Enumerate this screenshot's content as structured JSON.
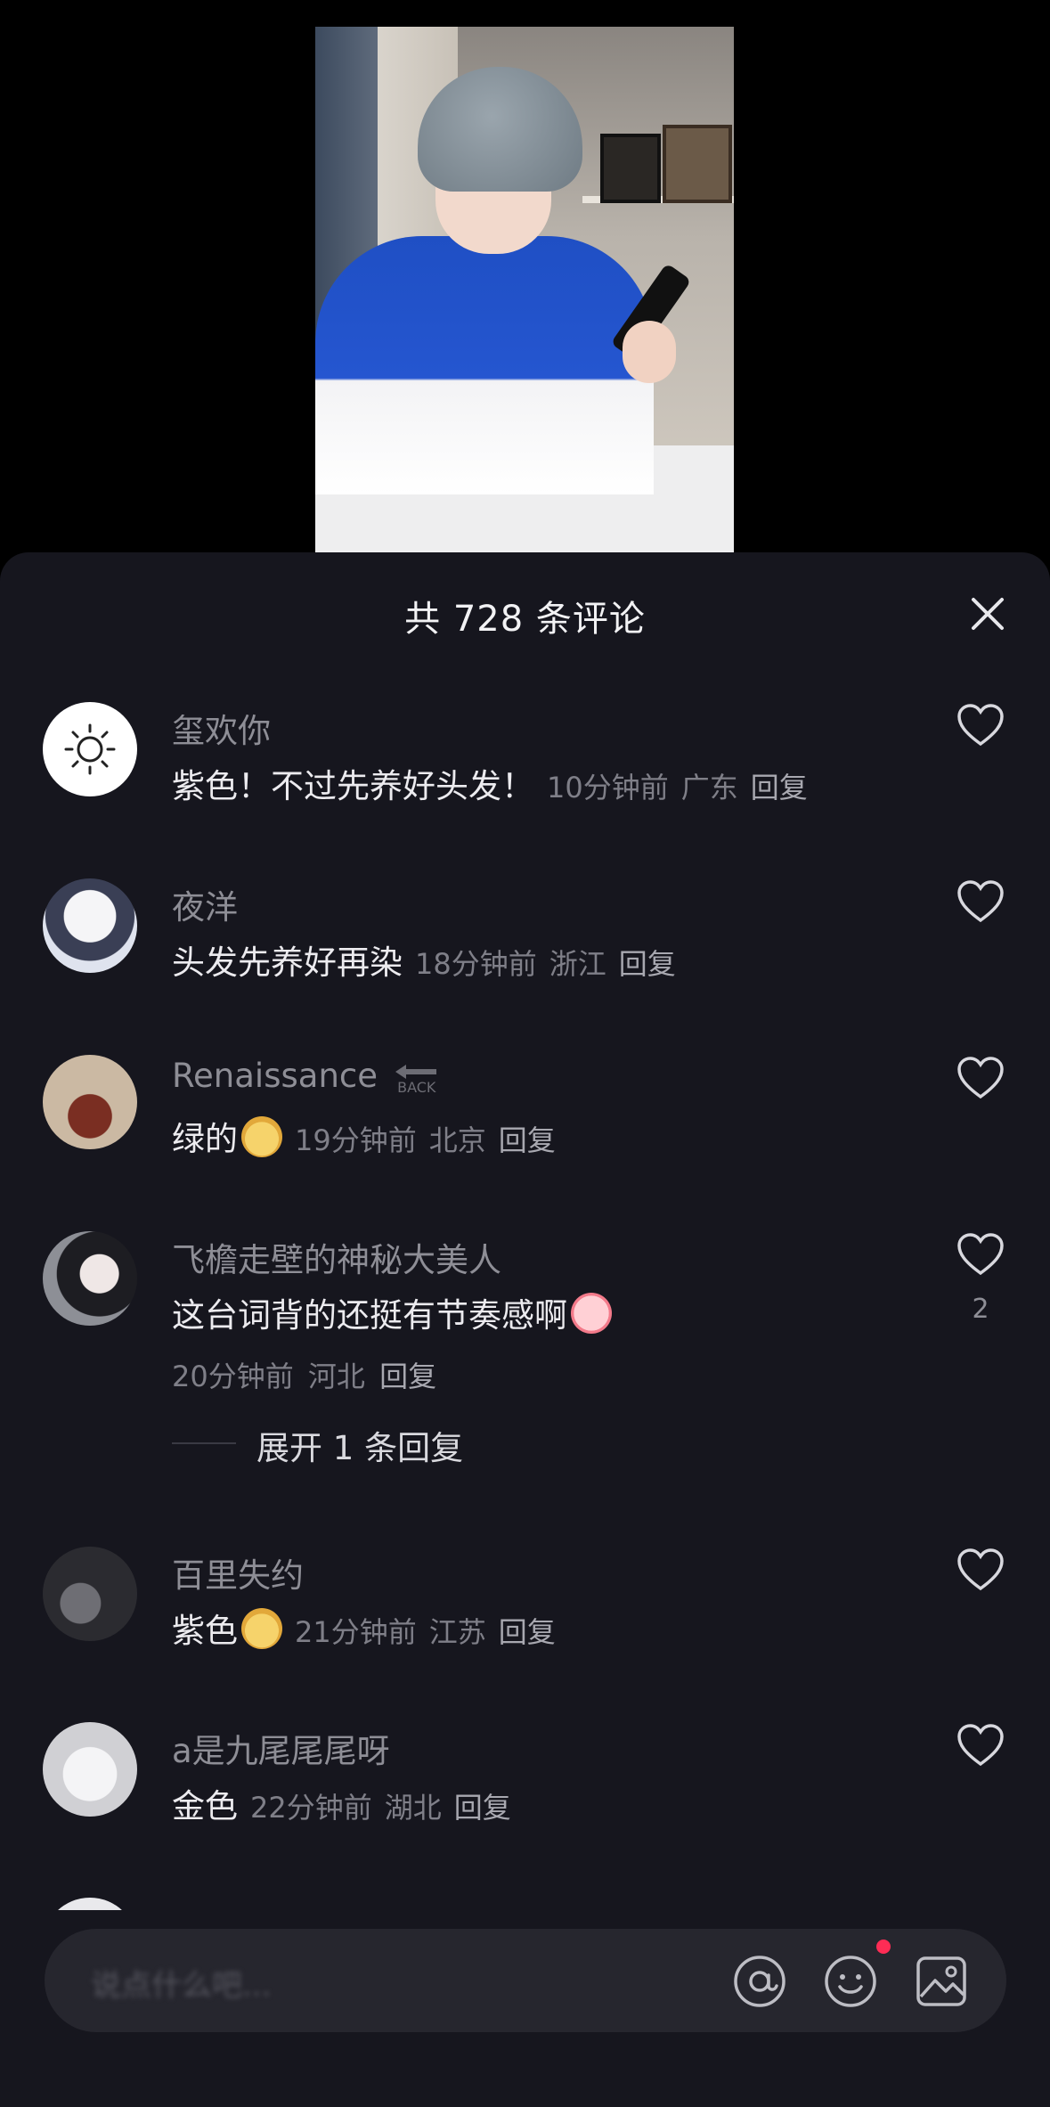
{
  "sheet": {
    "title": "共 728 条评论"
  },
  "comments": [
    {
      "username": "玺欢你",
      "text": "紫色！不过先养好头发！",
      "time": "10分钟前",
      "location": "广东",
      "reply": "回复",
      "likes": ""
    },
    {
      "username": "夜洋",
      "text": "头发先养好再染",
      "time": "18分钟前",
      "location": "浙江",
      "reply": "回复",
      "likes": ""
    },
    {
      "username": "Renaissance",
      "text": "绿的",
      "time": "19分钟前",
      "location": "北京",
      "reply": "回复",
      "likes": ""
    },
    {
      "username": "飞檐走壁的神秘大美人",
      "text": "这台词背的还挺有节奏感啊",
      "time": "20分钟前",
      "location": "河北",
      "reply": "回复",
      "likes": "2",
      "expand": "展开 1 条回复"
    },
    {
      "username": "百里失约",
      "text": "紫色",
      "time": "21分钟前",
      "location": "江苏",
      "reply": "回复",
      "likes": ""
    },
    {
      "username": "a是九尾尾尾呀",
      "text": "金色",
      "time": "22分钟前",
      "location": "湖北",
      "reply": "回复",
      "likes": ""
    }
  ],
  "input": {
    "placeholder": "说点什么吧..."
  },
  "badge": {
    "back": "BACK"
  },
  "icons": [
    "close-icon",
    "heart-icon",
    "at-icon",
    "emoji-icon",
    "image-icon"
  ],
  "colors": {
    "background": "#16161e",
    "accent": "#fe2c55"
  }
}
